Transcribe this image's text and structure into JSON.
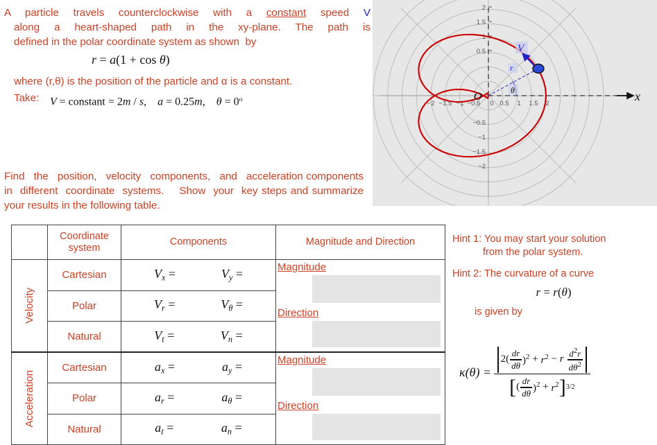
{
  "problem": {
    "line1_a": "A  particle  travels  counterclockwise  with  a  ",
    "line1_underlined": "constant",
    "line1_b": "  speed  ",
    "line1_symbol": "V",
    "line2": "along  a  heart-shaped  path  in  the  xy-plane.  The  path  is",
    "line3": "defined in the polar coordinate system as shown  by",
    "equation_path": "r = a(1 + cos θ)",
    "line4": "where (r,θ) is the position of the particle and α is a constant.",
    "line5": "Take:",
    "given_values": "V = constant = 2m / s,    a = 0.25m,    θ = 0°",
    "task": "Find   the   position,   velocity   components,   and   acceleration components  in  different  coordinate  systems.    Show  your  key steps and summarize your results in the following table."
  },
  "figure": {
    "x_axis_label": "x",
    "origin_label": "O",
    "radius_label": "r",
    "angle_label": "θ",
    "velocity_label": "V",
    "curve_color": "#CC0000",
    "vector_color": "#2222CC",
    "background": "#E7E7E7"
  },
  "chart_data": {
    "type": "line",
    "title": "",
    "plot_kind": "polar-cardioid",
    "equation": "r = a(1 + cos(theta))",
    "parameter_a": 1.0,
    "xlabel": "x",
    "ylabel": "",
    "xlim": [
      -2.35,
      2.35
    ],
    "ylim": [
      -2.35,
      2.35
    ],
    "xticks": [
      "-2",
      "-1.5",
      "-1",
      "-0.5",
      "0",
      "0.5",
      "1",
      "1.5",
      "2"
    ],
    "xtick_values": [
      -2,
      -1.5,
      -1,
      -0.5,
      0,
      0.5,
      1,
      1.5,
      2
    ],
    "yticks": [
      "2",
      "1.5",
      "1",
      "0.5",
      "0",
      "-0.5",
      "-1",
      "-1.5",
      "-2"
    ],
    "ytick_values": [
      2,
      1.5,
      1,
      0.5,
      0,
      -0.5,
      -1,
      -1.5,
      -2
    ],
    "grid": "polar",
    "polar_grid_radii": [
      0.5,
      1.0,
      1.5,
      2.0
    ],
    "polar_grid_angles_deg": [
      0,
      45,
      90,
      135,
      180,
      225,
      270,
      315
    ],
    "legend": "none",
    "annotations": [
      {
        "name": "particle",
        "x": 1.71,
        "y": 0.93,
        "label": ""
      },
      {
        "name": "velocity-vector",
        "from": [
          1.71,
          0.93
        ],
        "to": [
          1.18,
          1.45
        ],
        "label": "V"
      },
      {
        "name": "radius-line",
        "from": [
          0.0,
          0.0
        ],
        "to": [
          1.71,
          0.93
        ],
        "label": "r"
      },
      {
        "name": "angle-arc",
        "label": "θ",
        "x": 0.55,
        "y": 0.16
      },
      {
        "name": "origin",
        "label": "O",
        "x": -0.18,
        "y": -0.05
      }
    ]
  },
  "table": {
    "headers": {
      "corner": "",
      "coordinate_system": "Coordinate\nsystem",
      "components": "Components",
      "magnitude_direction": "Magnitude and Direction"
    },
    "groups": [
      {
        "label": "Velocity",
        "rows": [
          {
            "system": "Cartesian",
            "comp1": "Vx =",
            "comp2": "Vy ="
          },
          {
            "system": "Polar",
            "comp1": "Vr =",
            "comp2": "Vθ ="
          },
          {
            "system": "Natural",
            "comp1": "Vt =",
            "comp2": "Vn ="
          }
        ],
        "magnitude_label": "Magnitude",
        "magnitude_value": "",
        "direction_label": "Direction",
        "direction_value": ""
      },
      {
        "label": "Acceleration",
        "rows": [
          {
            "system": "Cartesian",
            "comp1": "ax =",
            "comp2": "ay ="
          },
          {
            "system": "Polar",
            "comp1": "ar =",
            "comp2": "aθ ="
          },
          {
            "system": "Natural",
            "comp1": "at =",
            "comp2": "an ="
          }
        ],
        "magnitude_label": "Magnitude",
        "magnitude_value": "",
        "direction_label": "Direction",
        "direction_value": ""
      }
    ]
  },
  "hints": {
    "hint1_line1": "Hint 1: You may start your solution",
    "hint1_line2": "from the polar system.",
    "hint2_line1": "Hint 2: The curvature of a curve",
    "hint2_equation": "r = r(θ)",
    "hint2_line2": "is given by",
    "curvature_formula": "κ(θ) = |2(dr/dθ)² + r² − r d²r/dθ²| / [(dr/dθ)² + r²]^(3/2)"
  },
  "colors": {
    "text_orange": "#CC4125",
    "math_blue": "#2222CC",
    "curve_red": "#CC0000",
    "answer_box_gray": "#E4E4E4"
  }
}
